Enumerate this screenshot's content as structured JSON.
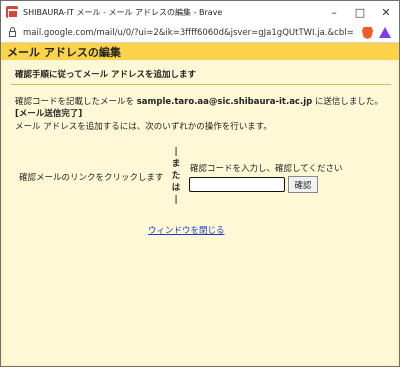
{
  "window": {
    "title": "SHIBAURA-IT メール - メール アドレスの編集 - Brave",
    "controls": {
      "minimize": "–",
      "maximize": "□",
      "close": "✕"
    }
  },
  "address_bar": {
    "url": "mail.google.com/mail/u/0/?ui=2&ik=3ffff6060d&jsver=gJa1gQUtTWI.ja.&cbl=g..."
  },
  "header": {
    "title": "メール アドレスの編集"
  },
  "content": {
    "section_title": "確認手順に従ってメール アドレスを追加します",
    "sent_prefix": "確認コードを記載したメールを ",
    "email": "sample.taro.aa@sic.shibaura-it.ac.jp",
    "sent_suffix": " に送信しました。",
    "sent_badge": "[メール送信完了]",
    "instructions": "メール アドレスを追加するには、次のいずれかの操作を行います。",
    "option_link": "確認メールのリンクをクリックします",
    "or_text": [
      "|",
      "ま",
      "た",
      "は",
      "|"
    ],
    "option_code": "確認コードを入力し、確認してください",
    "code_value": "",
    "confirm_label": "確認",
    "close_link": "ウィンドウを閉じる"
  }
}
